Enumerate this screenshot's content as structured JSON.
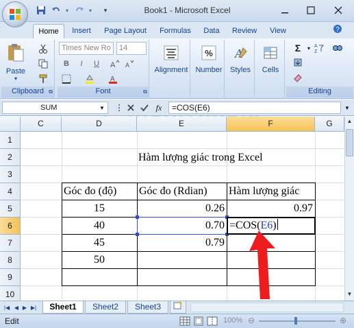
{
  "window": {
    "title": "Book1 - Microsoft Excel"
  },
  "tabs": [
    "Home",
    "Insert",
    "Page Layout",
    "Formulas",
    "Data",
    "Review",
    "View"
  ],
  "ribbon": {
    "clipboard": {
      "label": "Clipboard",
      "paste": "Paste"
    },
    "font": {
      "label": "Font",
      "family": "Times New Ro",
      "size": "14",
      "bold": "B",
      "italic": "I",
      "underline": "U"
    },
    "alignment": {
      "label": "Alignment"
    },
    "number": {
      "label": "Number",
      "symbol": "%"
    },
    "styles": {
      "label": "Styles"
    },
    "cells": {
      "label": "Cells"
    },
    "editing": {
      "label": "Editing"
    }
  },
  "formula_bar": {
    "name_box": "SUM",
    "formula": "=COS(E6)",
    "fx": "fx"
  },
  "columns": [
    "C",
    "D",
    "E",
    "F",
    "G"
  ],
  "rows": [
    "1",
    "2",
    "3",
    "4",
    "5",
    "6",
    "7",
    "8",
    "9",
    "10"
  ],
  "cells": {
    "E2": "Hàm lượng giác trong Excel",
    "D4": "Góc đo (độ)",
    "E4": "Góc đo (Rdian)",
    "F4": "Hàm lượng giác",
    "D5": "15",
    "E5": "0.26",
    "F5": "0.97",
    "D6": "40",
    "E6": "0.70",
    "F6_prefix": "=COS(",
    "F6_ref": "E6",
    "F6_suffix": ")",
    "D7": "45",
    "E7": "0.79",
    "D8": "50"
  },
  "sheets": [
    "Sheet1",
    "Sheet2",
    "Sheet3"
  ],
  "status": {
    "mode": "Edit",
    "zoom": "100%"
  },
  "colors": {
    "ref_blue": "#1f3fbf",
    "arrow_red": "#ee1c1c",
    "selected_header": "#f6c152"
  }
}
